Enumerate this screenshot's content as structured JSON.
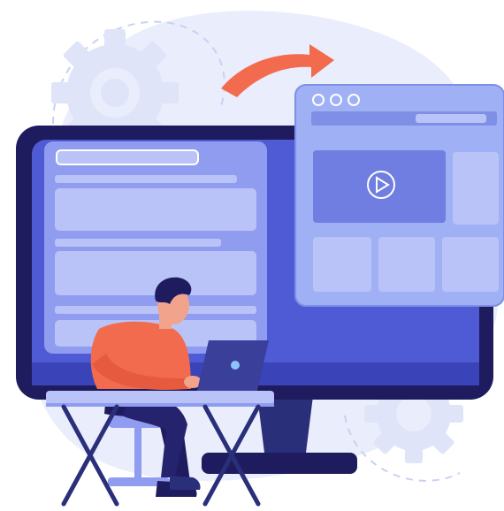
{
  "illustration": {
    "colors": {
      "monitor_frame": "#1e1b5e",
      "monitor_screen": "#4f5bd5",
      "panel": "#8f9cf0",
      "panel_light": "#b9c3f7",
      "background_blob": "#e8ecfb",
      "gear": "#dfe4f8",
      "arrow": "#f26b4f",
      "browser_window": "#9fb0f4",
      "shirt": "#f26b4f",
      "pants": "#1e1b5e",
      "skin": "#f2a38b",
      "hair": "#1e1b5e",
      "laptop": "#3a3f9a",
      "desk_frame": "#2a2f7a",
      "desk_top": "#b9c3f7"
    },
    "icons": [
      "gear-icon",
      "arrow-icon",
      "play-icon",
      "window-dots-icon"
    ]
  }
}
